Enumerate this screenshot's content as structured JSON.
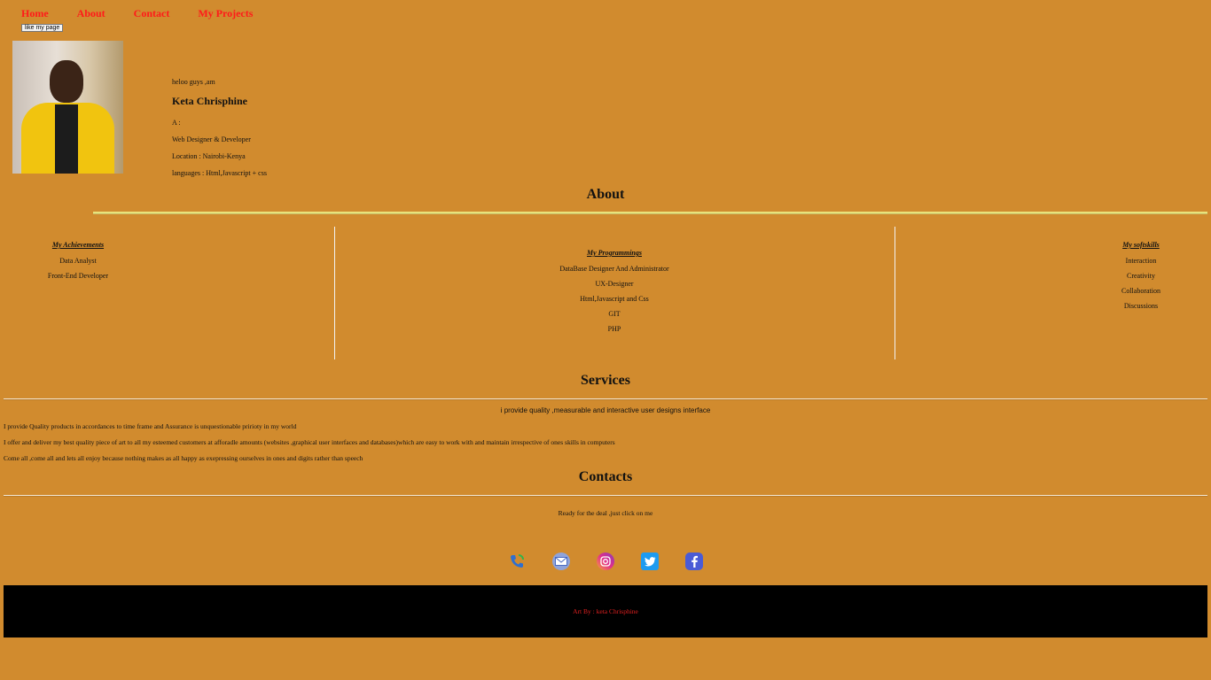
{
  "nav": {
    "items": [
      "Home",
      "About",
      "Contact",
      "My Projects"
    ],
    "like_button": "like my page"
  },
  "profile": {
    "greeting": "heloo guys ,am",
    "name": "Keta Chrisphine",
    "a_label": "A :",
    "role": "Web Designer & Developer",
    "location": "Location : Nairobi-Kenya",
    "languages": "languages : Html,Javascript + css"
  },
  "about": {
    "heading": "About",
    "achievements": {
      "title": "My Achievements",
      "items": [
        "Data Analyst",
        "Front-End Developer"
      ]
    },
    "programmings": {
      "title": "My Programmings",
      "items": [
        "DataBase Designer And Administrator",
        "UX-Designer",
        "Html,Javascript and Css",
        "GIT",
        "PHP"
      ]
    },
    "softskills": {
      "title": "My softskills",
      "items": [
        "Interaction",
        "Creativity",
        "Collaboration",
        "Discussions"
      ]
    }
  },
  "services": {
    "heading": "Services",
    "lead": "i provide quality ,measurable and interactive user designs interface",
    "paragraphs": [
      "I provide Quality products in accordances to time frame and Assurance is unquestionable pririoty in my world",
      "I offer and deliver my best quality piece of art to all my esteemed customers at afforadle amounts (websites ,graphical user interfaces and databases)which are easy to work with and maintain irrespective of ones skills in computers",
      "Come all ,come all and lets all enjoy because nothing makes as all happy as exepressing ourselves in ones and digits rather than speech"
    ]
  },
  "contacts": {
    "heading": "Contacts",
    "lead": "Ready for the deal ,just click on me",
    "icons": [
      "phone-icon",
      "mail-icon",
      "instagram-icon",
      "twitter-icon",
      "facebook-icon"
    ]
  },
  "footer": {
    "credit": "Art By : keta Chrisphine"
  },
  "colors": {
    "background": "#d18b2e",
    "nav_link": "#ff1a1a",
    "footer": "#000000",
    "footer_text": "#e02020",
    "about_rule": "#e9e37c"
  }
}
